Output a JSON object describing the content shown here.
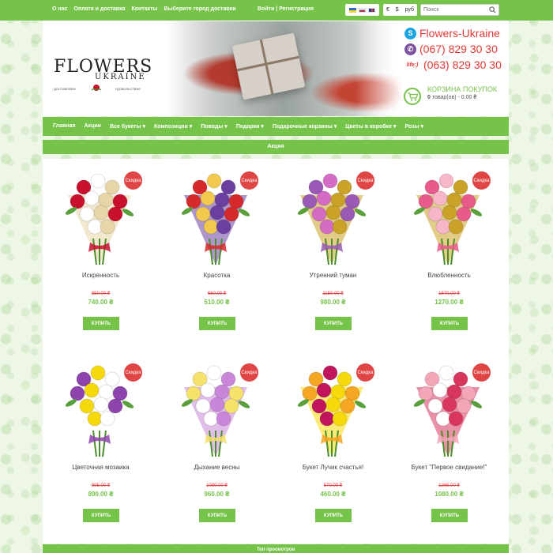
{
  "topbar": {
    "links": [
      "О нас",
      "Оплата и доставка",
      "Контакты",
      "Выберите город доставки"
    ],
    "auth": "Войти | Регистрация",
    "currency": {
      "symbols": [
        "€",
        "$",
        "руб"
      ]
    },
    "search_placeholder": "Поиск"
  },
  "header": {
    "logo": {
      "line1": "FLOWERS",
      "line2": "UKRAINE",
      "tag_left": "ДОСТАВЛЯЕМ",
      "tag_right": "УДОВОЛЬСТВИЕ"
    },
    "contacts": {
      "skype": "Flowers-Ukraine",
      "viber": "(067) 829 30 30",
      "life_label": "life:)",
      "life": "(063) 829 30 30"
    },
    "cart": {
      "title": "КОРЗИНА ПОКУПОК",
      "count": "0",
      "summary": "товар(ов) - 0.00 ₴"
    }
  },
  "nav": {
    "items": [
      "Главная",
      "Акции",
      "Все букеты ▾",
      "Композиции ▾",
      "Поводы ▾",
      "Подарки ▾",
      "Подарочные корзины ▾",
      "Цветы в коробке ▾",
      "Розы ▾"
    ]
  },
  "section_title": "Акция",
  "badge_label": "Скидка",
  "buy_label": "КУПИТЬ",
  "products": [
    {
      "name": "Искренность",
      "old_price": "850.00 ₴",
      "price": "740.00 ₴",
      "palette": [
        "#c8102e",
        "#ffffff",
        "#e8d6a8"
      ]
    },
    {
      "name": "Красотка",
      "old_price": "680.00 ₴",
      "price": "510.00 ₴",
      "palette": [
        "#d62a2a",
        "#f2c94c",
        "#6b3fa0"
      ]
    },
    {
      "name": "Утренний туман",
      "old_price": "1150.00 ₴",
      "price": "980.00 ₴",
      "palette": [
        "#9b59b6",
        "#d46bc4",
        "#c9a227"
      ]
    },
    {
      "name": "Влюбленность",
      "old_price": "1570.00 ₴",
      "price": "1270.00 ₴",
      "palette": [
        "#e85a8a",
        "#f8b6c9",
        "#c9a227"
      ]
    },
    {
      "name": "Цветочная мозаика",
      "old_price": "995.00 ₴",
      "price": "890.00 ₴",
      "palette": [
        "#8e44ad",
        "#f5d90a",
        "#ffffff"
      ]
    },
    {
      "name": "Дыхание весны",
      "old_price": "1080.00 ₴",
      "price": "960.00 ₴",
      "palette": [
        "#f5e26b",
        "#ffffff",
        "#c986d9"
      ]
    },
    {
      "name": "Букет Лучик счастья!",
      "old_price": "570.00 ₴",
      "price": "460.00 ₴",
      "palette": [
        "#f5a623",
        "#c0145c",
        "#f5d90a"
      ]
    },
    {
      "name": "Букет \"Первое свидание!\"",
      "old_price": "1265.00 ₴",
      "price": "1080.00 ₴",
      "palette": [
        "#f2a6b8",
        "#ffffff",
        "#d9365e"
      ]
    }
  ],
  "footer_title": "Топ просмотров"
}
